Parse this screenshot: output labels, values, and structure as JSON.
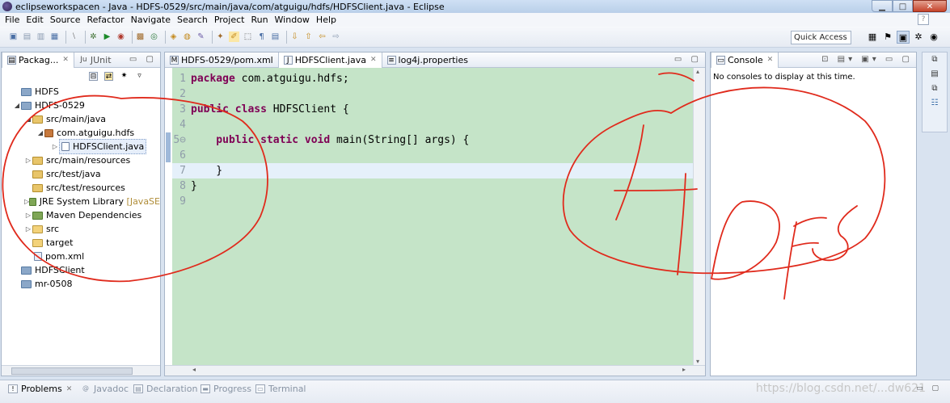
{
  "window": {
    "title": "eclipseworkspacen - Java - HDFS-0529/src/main/java/com/atguigu/hdfs/HDFSClient.java - Eclipse",
    "min": "▁",
    "max": "□",
    "close": "✕"
  },
  "menu": [
    "File",
    "Edit",
    "Source",
    "Refactor",
    "Navigate",
    "Search",
    "Project",
    "Run",
    "Window",
    "Help"
  ],
  "help_mark": "?",
  "quick_access": {
    "placeholder": "Quick Access"
  },
  "package_explorer": {
    "tabs": [
      {
        "label": "Packag...",
        "icon": "package-icon"
      },
      {
        "label": "JUnit",
        "icon": "junit-icon"
      }
    ],
    "tree": [
      {
        "label": "HDFS",
        "icon": "project-icon"
      },
      {
        "label": "HDFS-0529",
        "icon": "project-icon"
      },
      {
        "label": "src/main/java",
        "icon": "source-folder-icon"
      },
      {
        "label": "com.atguigu.hdfs",
        "icon": "package-icon"
      },
      {
        "label": "HDFSClient.java",
        "icon": "java-file-icon"
      },
      {
        "label": "src/main/resources",
        "icon": "source-folder-icon"
      },
      {
        "label": "src/test/java",
        "icon": "source-folder-icon"
      },
      {
        "label": "src/test/resources",
        "icon": "source-folder-icon"
      },
      {
        "label": "JRE System Library",
        "tail": "[JavaSE",
        "icon": "library-icon"
      },
      {
        "label": "Maven Dependencies",
        "icon": "library-icon"
      },
      {
        "label": "src",
        "icon": "folder-icon"
      },
      {
        "label": "target",
        "icon": "folder-icon"
      },
      {
        "label": "pom.xml",
        "icon": "xml-file-icon"
      },
      {
        "label": "HDFSClient",
        "icon": "project-icon"
      },
      {
        "label": "mr-0508",
        "icon": "project-icon"
      }
    ]
  },
  "editor": {
    "tabs": [
      {
        "label": "HDFS-0529/pom.xml",
        "icon": "maven-pom-icon"
      },
      {
        "label": "HDFSClient.java",
        "icon": "java-file-icon"
      },
      {
        "label": "log4j.properties",
        "icon": "properties-file-icon"
      }
    ],
    "lines": [
      {
        "n": "1",
        "kw": "package",
        "text": " com.atguigu.hdfs;"
      },
      {
        "n": "2",
        "kw": "",
        "text": ""
      },
      {
        "n": "3",
        "kw": "public class",
        "text": " HDFSClient {"
      },
      {
        "n": "4",
        "kw": "",
        "text": ""
      },
      {
        "n": "5⊖",
        "kw": "    public static void",
        "text": " main(String[] args) {"
      },
      {
        "n": "6",
        "kw": "",
        "text": ""
      },
      {
        "n": "7",
        "kw": "",
        "text": "    }"
      },
      {
        "n": "8",
        "kw": "",
        "text": "}"
      },
      {
        "n": "9",
        "kw": "",
        "text": ""
      }
    ]
  },
  "console": {
    "tab": "Console",
    "message": "No consoles to display at this time."
  },
  "bottom_tabs": [
    "Problems",
    "Javadoc",
    "Declaration",
    "Progress",
    "Terminal"
  ],
  "watermark": "https://blog.csdn.net/...dw621",
  "colors": {
    "code_background": "#c5e4c8",
    "keyword": "#7f0055",
    "annotation_ink": "#e02a1c"
  }
}
